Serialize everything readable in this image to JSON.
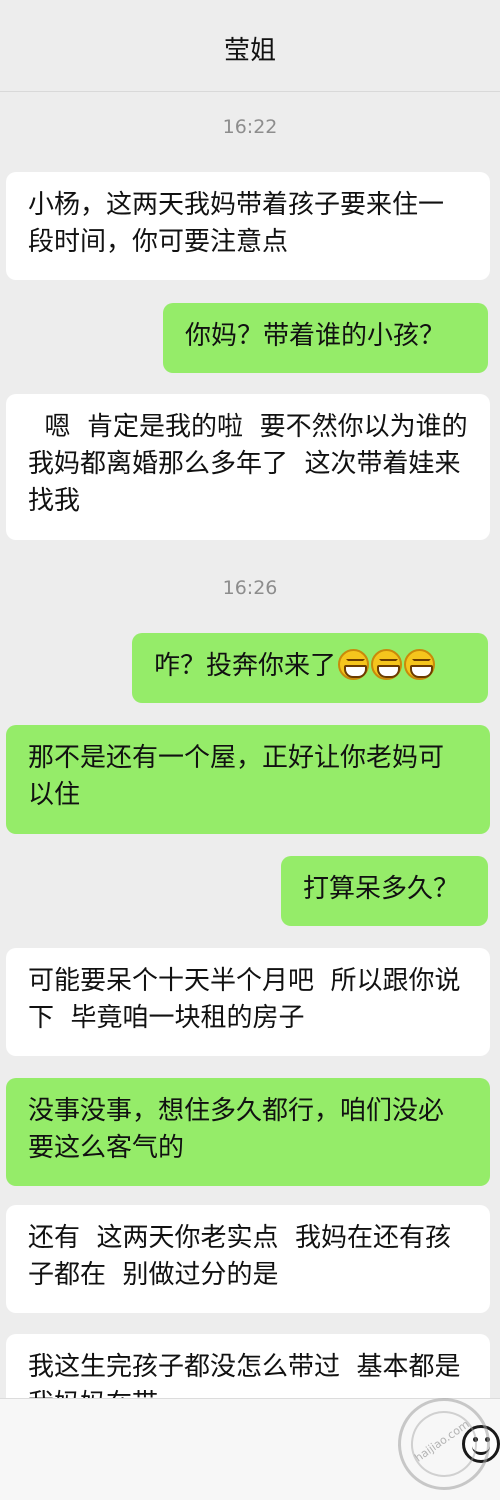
{
  "header": {
    "title": "莹姐"
  },
  "timestamps": [
    "16:22",
    "16:26"
  ],
  "messages": [
    {
      "side": "received",
      "text": "小杨，这两天我妈带着孩子要来住一段时间，你可要注意点"
    },
    {
      "side": "sent",
      "text": "你妈？带着谁的小孩？"
    },
    {
      "side": "received",
      "text": "  嗯  肯定是我的啦  要不然你以为谁的  我妈都离婚那么多年了  这次带着娃来找我"
    },
    {
      "side": "sent",
      "text": "咋？投奔你来了",
      "emoji": [
        "grin-icon",
        "grin-icon",
        "grin-icon"
      ]
    },
    {
      "side": "sent",
      "text": "那不是还有一个屋，正好让你老妈可以住"
    },
    {
      "side": "sent",
      "text": "打算呆多久？"
    },
    {
      "side": "received",
      "text": "可能要呆个十天半个月吧  所以跟你说下  毕竟咱一块租的房子"
    },
    {
      "side": "sent",
      "text": "没事没事，想住多久都行，咱们没必要这么客气的"
    },
    {
      "side": "received",
      "text": "还有  这两天你老实点  我妈在还有孩子都在  别做过分的是"
    },
    {
      "side": "received",
      "text": "我这生完孩子都没怎么带过  基本都是我妈妈在带"
    }
  ],
  "watermark": {
    "text": "haijiao.com"
  },
  "colors": {
    "sent_bubble": "#95ec69",
    "received_bubble": "#ffffff",
    "background": "#ededed"
  }
}
